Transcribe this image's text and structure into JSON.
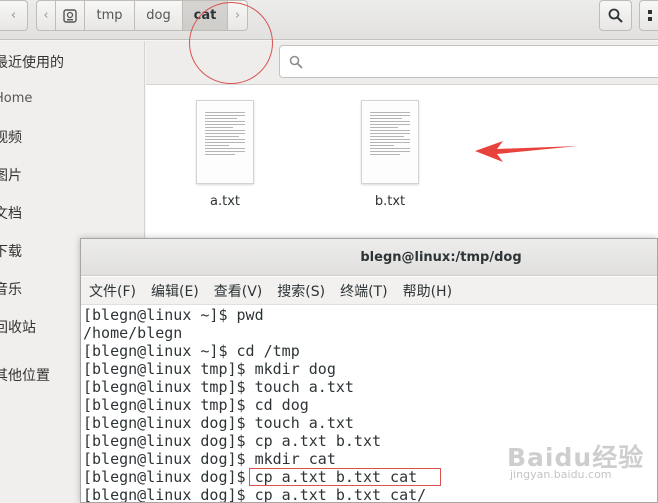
{
  "file_manager": {
    "path_segments": [
      "tmp",
      "dog",
      "cat"
    ],
    "active_segment": "cat",
    "sidebar": [
      "最近使用的",
      "Home",
      "视频",
      "图片",
      "文档",
      "下载",
      "音乐",
      "回收站",
      "其他位置"
    ],
    "files": [
      "a.txt",
      "b.txt"
    ]
  },
  "terminal": {
    "title": "blegn@linux:/tmp/dog",
    "menu": [
      "文件(F)",
      "编辑(E)",
      "查看(V)",
      "搜索(S)",
      "终端(T)",
      "帮助(H)"
    ],
    "lines": [
      "[blegn@linux ~]$ pwd",
      "/home/blegn",
      "[blegn@linux ~]$ cd /tmp",
      "[blegn@linux tmp]$ mkdir dog",
      "[blegn@linux tmp]$ touch a.txt",
      "[blegn@linux tmp]$ cd dog",
      "[blegn@linux dog]$ touch a.txt",
      "[blegn@linux dog]$ cp a.txt b.txt",
      "[blegn@linux dog]$ mkdir cat",
      "[blegn@linux dog]$ cp a.txt b.txt cat",
      "[blegn@linux dog]$ cp a.txt b.txt cat/"
    ]
  },
  "watermark": {
    "text": "Baidu经验",
    "sub": "jingyan.baidu.com"
  },
  "colors": {
    "annotation_red": "#d9534f",
    "arrow_red": "#e8423c"
  }
}
